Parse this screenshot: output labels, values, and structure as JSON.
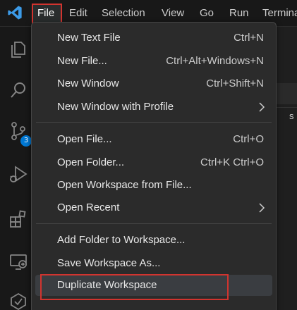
{
  "colors": {
    "accent": "#0078d4",
    "highlight_border": "#d1342f",
    "menu_background": "#2b2b2b",
    "hover_background": "#3a3d41",
    "activity_background": "#181818"
  },
  "menubar": {
    "logo_icon": "vscode-logo-icon",
    "items": [
      "File",
      "Edit",
      "Selection",
      "View",
      "Go",
      "Run",
      "Terminal"
    ]
  },
  "activitybar": {
    "icons": [
      "explorer-icon",
      "search-icon",
      "source-control-icon",
      "run-debug-icon",
      "extensions-icon",
      "remote-explorer-icon",
      "accounts-icon"
    ],
    "source_control_badge": "3"
  },
  "file_menu": {
    "groups": [
      {
        "items": [
          {
            "label": "New Text File",
            "shortcut": "Ctrl+N"
          },
          {
            "label": "New File...",
            "shortcut": "Ctrl+Alt+Windows+N"
          },
          {
            "label": "New Window",
            "shortcut": "Ctrl+Shift+N"
          },
          {
            "label": "New Window with Profile",
            "submenu": true
          }
        ]
      },
      {
        "items": [
          {
            "label": "Open File...",
            "shortcut": "Ctrl+O"
          },
          {
            "label": "Open Folder...",
            "shortcut": "Ctrl+K Ctrl+O"
          },
          {
            "label": "Open Workspace from File..."
          },
          {
            "label": "Open Recent",
            "submenu": true
          }
        ]
      },
      {
        "items": [
          {
            "label": "Add Folder to Workspace..."
          },
          {
            "label": "Save Workspace As..."
          },
          {
            "label": "Duplicate Workspace",
            "hovered": true
          }
        ]
      }
    ]
  },
  "editor": {
    "right_edge_text": "s"
  }
}
